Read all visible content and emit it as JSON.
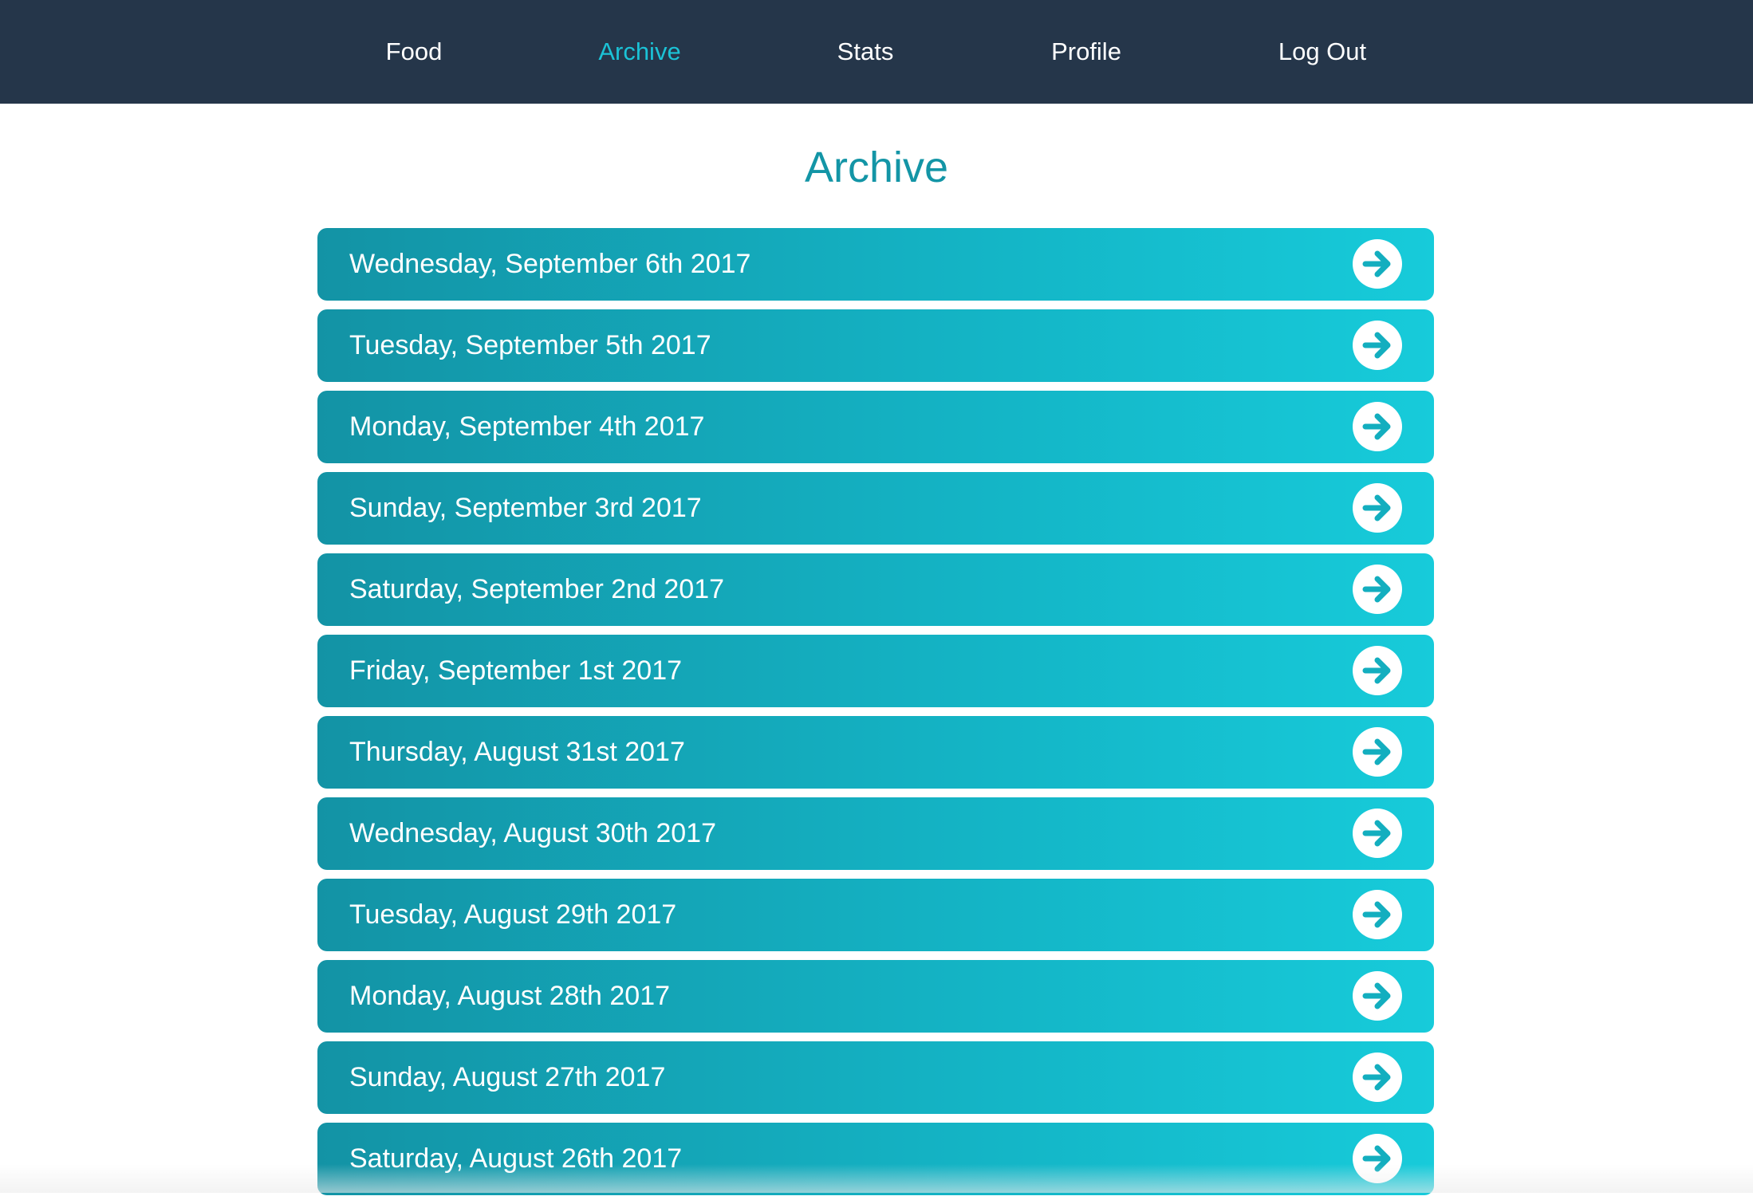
{
  "nav": {
    "items": [
      {
        "label": "Food",
        "active": false
      },
      {
        "label": "Archive",
        "active": true
      },
      {
        "label": "Stats",
        "active": false
      },
      {
        "label": "Profile",
        "active": false
      },
      {
        "label": "Log Out",
        "active": false
      }
    ]
  },
  "page": {
    "title": "Archive"
  },
  "archive": {
    "days": [
      {
        "label": "Wednesday, September 6th 2017",
        "icon": "arrow-right-circle-icon"
      },
      {
        "label": "Tuesday, September 5th 2017",
        "icon": "arrow-right-circle-icon"
      },
      {
        "label": "Monday, September 4th 2017",
        "icon": "arrow-right-circle-icon"
      },
      {
        "label": "Sunday, September 3rd 2017",
        "icon": "arrow-right-circle-icon"
      },
      {
        "label": "Saturday, September 2nd 2017",
        "icon": "arrow-right-circle-icon"
      },
      {
        "label": "Friday, September 1st 2017",
        "icon": "arrow-right-circle-icon"
      },
      {
        "label": "Thursday, August 31st 2017",
        "icon": "arrow-right-circle-icon"
      },
      {
        "label": "Wednesday, August 30th 2017",
        "icon": "arrow-right-circle-icon"
      },
      {
        "label": "Tuesday, August 29th 2017",
        "icon": "arrow-right-circle-icon"
      },
      {
        "label": "Monday, August 28th 2017",
        "icon": "arrow-right-circle-icon"
      },
      {
        "label": "Sunday, August 27th 2017",
        "icon": "arrow-right-circle-icon"
      },
      {
        "label": "Saturday, August 26th 2017",
        "icon": "arrow-right-circle-icon"
      }
    ]
  },
  "colors": {
    "nav_background": "#25364a",
    "nav_text": "#ffffff",
    "nav_active": "#1bc2d6",
    "title": "#1395a6",
    "row_gradient_start": "#1393a5",
    "row_gradient_end": "#17cbda",
    "row_text": "#ffffff"
  }
}
